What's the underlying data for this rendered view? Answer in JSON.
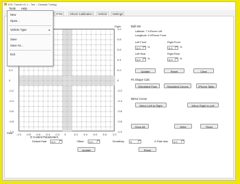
{
  "window": {
    "title": "EVL Tunnel v1.1 - Terr - Chassis Tuning"
  },
  "menu": {
    "items": [
      "Tools",
      "Help"
    ]
  },
  "dropdown": {
    "items": [
      {
        "label": "New"
      },
      {
        "label": "Open..."
      },
      {
        "label": "Vehicle Type",
        "submenu_arrow": "▸"
      },
      {
        "label": "Save"
      },
      {
        "label": "Save As..."
      },
      {
        "label": "Exit"
      }
    ]
  },
  "tabs": [
    "peed",
    "RTM",
    "Shock Calibration",
    "Vehicle",
    "Settings"
  ],
  "grid": {
    "label_left": "Left",
    "label_right": "Right",
    "label_rear": "Rear",
    "y_ticks": [
      "1.0",
      "0.8",
      "0.6",
      "0.4",
      "0.2",
      "0",
      "-0.2",
      "-0.4",
      "-0.6",
      "-0.8",
      "-1.0"
    ],
    "right_ticks": [
      "1.0",
      "0.8",
      "0.6",
      "0.4",
      "0.2",
      "0",
      "-0.2",
      "-0.4",
      "-0.6",
      "-0.8",
      "-1.0"
    ],
    "x_ticks": [
      "-1.0",
      "-0.8",
      "-0.6",
      "-0.4",
      "-0.2",
      "0",
      "0.2",
      "0.4",
      "0.6",
      "0.8",
      "1.0"
    ]
  },
  "ball_set": {
    "title": "Ball Set",
    "lat": "Latitude: 7.1/Rover Left",
    "long": "Longitude: 0.0/Rover Front",
    "left_front_label": "Left Front",
    "right_front_label": "Right Front",
    "left_rear_label": "Left Rear",
    "right_rear_label": "Right Rear",
    "left_front": "0.0",
    "right_front": "0.0",
    "left_rear": "0.0",
    "right_rear": "0.0",
    "unit": "%",
    "buttons": [
      "Update",
      "Reset",
      "Clear"
    ]
  },
  "fit_curve": {
    "title": "Fit Shape Calc",
    "buttons": [
      "Simulated Flow",
      "Simulated Curves",
      "iPhone Table"
    ]
  },
  "mirror": {
    "title": "Mirror Curve",
    "buttons": [
      "Mirror Left to Right",
      "Mirror Right to Left"
    ]
  },
  "bottom_buttons": [
    "Clear All",
    "Write",
    "Read"
  ],
  "g_control": {
    "title": "G Control Parameters",
    "default_rate_label": "Default Rate",
    "default_rate": "0.0",
    "offset_label": "Offset",
    "offset": "0.0",
    "sensitivity_label": "Sensitivity",
    "sensitivity": "0",
    "g_rate_max_label": "G Rate Max",
    "g_rate_max": "0.0",
    "update": "Update",
    "reset": "Reset"
  },
  "colors": {
    "background": "#f0e800",
    "grid_highlight": "#dcdcdc"
  }
}
